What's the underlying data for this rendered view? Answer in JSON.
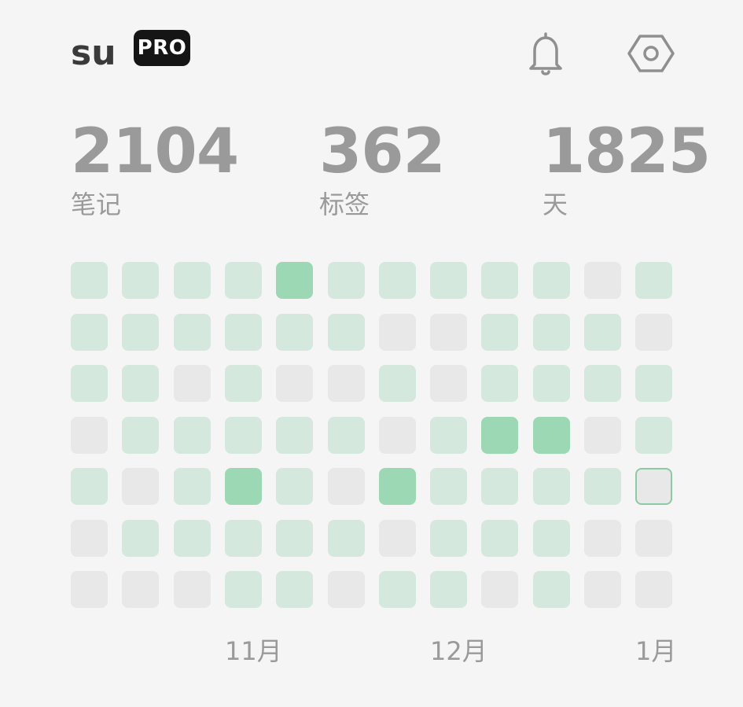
{
  "header": {
    "username": "su",
    "badge": "PRO",
    "notification_icon": "bell-icon",
    "settings_icon": "hex-gear-icon"
  },
  "stats": [
    {
      "value": "2104",
      "label": "笔记"
    },
    {
      "value": "362",
      "label": "标签"
    },
    {
      "value": "1825",
      "label": "天"
    }
  ],
  "heatmap": {
    "levels": [
      [
        1,
        1,
        1,
        1,
        2,
        1,
        1,
        1,
        1,
        1,
        0,
        1
      ],
      [
        1,
        1,
        1,
        1,
        1,
        1,
        0,
        0,
        1,
        1,
        1,
        0
      ],
      [
        1,
        1,
        0,
        1,
        0,
        0,
        1,
        0,
        1,
        1,
        1,
        1
      ],
      [
        0,
        1,
        1,
        1,
        1,
        1,
        0,
        1,
        2,
        2,
        0,
        1
      ],
      [
        1,
        0,
        1,
        2,
        1,
        0,
        2,
        1,
        1,
        1,
        1,
        "today"
      ],
      [
        0,
        1,
        1,
        1,
        1,
        1,
        0,
        1,
        1,
        1,
        0,
        0
      ],
      [
        0,
        0,
        0,
        1,
        1,
        0,
        1,
        1,
        0,
        1,
        0,
        0
      ]
    ],
    "colors": {
      "empty": "#e8e8e8",
      "light": "#d5e8dd",
      "medium": "#9dd8b5",
      "today_border": "#8ccaa5"
    }
  },
  "months": [
    "11月",
    "12月",
    "1月"
  ]
}
